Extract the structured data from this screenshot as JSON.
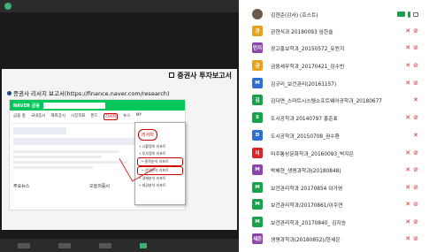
{
  "slide": {
    "title": "증권사 투자보고서",
    "subtitle": "증권사 리서치 보고서(https://finance.naver.com/research)",
    "naver_logo": "NAVER 금융",
    "menu": [
      "금융 홈",
      "국내증시",
      "해외증시",
      "시장지표",
      "펀드",
      "리서치",
      "뉴스",
      "MY"
    ],
    "active_menu": "리서치",
    "company_a": "주요뉴스",
    "company_b": "오늘의증시",
    "popup_header": "리서치",
    "popup_items": [
      "• 시황정보 리포트",
      "• 투자정보 리포트",
      "• 종목분석 리포트",
      "• 산업분석 리포트",
      "• 경제분석 리포트",
      "• 채권분석 리포트"
    ],
    "popup_highlight": [
      2,
      3
    ]
  },
  "participants": [
    {
      "name": "김현준(강사) (호스트)",
      "avatar": "",
      "color": "#6b5a4a",
      "host": true
    },
    {
      "name": "관현식과 20180093 임한솔",
      "avatar": "관",
      "color": "#e8a21a"
    },
    {
      "name": "광고홍보학과_20150572_유윈지",
      "avatar": "민지",
      "color": "#8e44ad"
    },
    {
      "name": "금융세무학과_20170421_김수빈",
      "avatar": "금",
      "color": "#e8a21a"
    },
    {
      "name": "김규리_보건관리(20161157)",
      "avatar": "M",
      "color": "#2f6fd1"
    },
    {
      "name": "김다연_스마트시스템소프트웨어공학과_20180677",
      "avatar": "김",
      "color": "#16a34a"
    },
    {
      "name": "도시공학과 20140797 홍준표",
      "avatar": "S",
      "color": "#16a34a"
    },
    {
      "name": "도시공학과_20150708_권수환",
      "avatar": "D",
      "color": "#2f6fd1"
    },
    {
      "name": "미주통상문화학과_20160093_박지은",
      "avatar": "미",
      "color": "#d9252a"
    },
    {
      "name": "박해현_생명과학과(20180848)",
      "avatar": "M",
      "color": "#8e44ad"
    },
    {
      "name": "보건관리학과 20170854 이가영",
      "avatar": "M",
      "color": "#16a34a"
    },
    {
      "name": "보건관리학과/20170861/이주연",
      "avatar": "M",
      "color": "#16a34a"
    },
    {
      "name": "보건관리학과_20170840_ 김지승",
      "avatar": "M",
      "color": "#16a34a"
    },
    {
      "name": "생명과학과(20180852)/한세은",
      "avatar": "세은",
      "color": "#8e44ad"
    }
  ],
  "icons": {
    "mic_off": "✕",
    "cam_off": "⊘"
  }
}
